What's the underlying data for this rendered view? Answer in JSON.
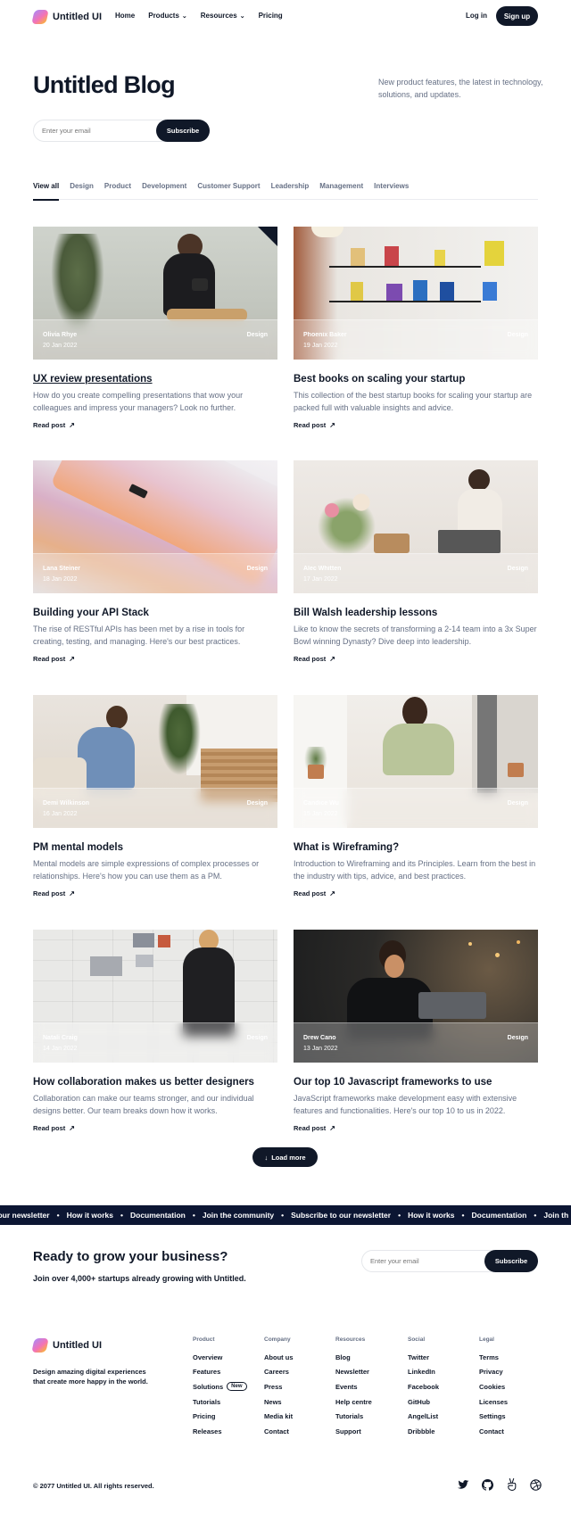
{
  "nav": {
    "brand": "Untitled UI",
    "links": [
      {
        "label": "Home"
      },
      {
        "label": "Products",
        "chevron": "⌄"
      },
      {
        "label": "Resources",
        "chevron": "⌄"
      },
      {
        "label": "Pricing"
      }
    ],
    "login": "Log in",
    "signup": "Sign up"
  },
  "hero": {
    "title": "Untitled Blog",
    "description": "New product features, the latest in technology, solutions, and updates.",
    "email_placeholder": "Enter your email",
    "subscribe": "Subscribe"
  },
  "tabs": [
    {
      "label": "View all",
      "active": true
    },
    {
      "label": "Design"
    },
    {
      "label": "Product"
    },
    {
      "label": "Development"
    },
    {
      "label": "Customer Support"
    },
    {
      "label": "Leadership"
    },
    {
      "label": "Management"
    },
    {
      "label": "Interviews"
    }
  ],
  "posts": [
    {
      "author": "Olivia Rhye",
      "date": "20 Jan 2022",
      "category": "Design",
      "title": "UX review presentations",
      "desc": "How do you create compelling presentations that wow your colleagues and impress your managers? Look no further.",
      "read": "Read post"
    },
    {
      "author": "Phoenix Baker",
      "date": "19 Jan 2022",
      "category": "Design",
      "title": "Best books on scaling your startup",
      "desc": "This collection of the best startup books for scaling your startup are packed full with valuable insights and advice.",
      "read": "Read post"
    },
    {
      "author": "Lana Steiner",
      "date": "18 Jan 2022",
      "category": "Design",
      "title": "Building your API Stack",
      "desc": "The rise of RESTful APIs has been met by a rise in tools for creating, testing, and managing. Here's our best practices.",
      "read": "Read post"
    },
    {
      "author": "Alec Whitten",
      "date": "17 Jan 2022",
      "category": "Design",
      "title": "Bill Walsh leadership lessons",
      "desc": "Like to know the secrets of transforming a 2-14 team into a 3x Super Bowl winning Dynasty? Dive deep into leadership.",
      "read": "Read post"
    },
    {
      "author": "Demi Wilkinson",
      "date": "16 Jan 2022",
      "category": "Design",
      "title": "PM mental models",
      "desc": "Mental models are simple expressions of complex processes or relationships. Here's how you can use them as a PM.",
      "read": "Read post"
    },
    {
      "author": "Candice Wu",
      "date": "15 Jan 2022",
      "category": "Design",
      "title": "What is Wireframing?",
      "desc": "Introduction to Wireframing and its Principles. Learn from the best in the industry with tips, advice, and best practices.",
      "read": "Read post"
    },
    {
      "author": "Natali Craig",
      "date": "14 Jan 2022",
      "category": "Design",
      "title": "How collaboration makes us better designers",
      "desc": "Collaboration can make our teams stronger, and our individual designs better. Our team breaks down how it works.",
      "read": "Read post"
    },
    {
      "author": "Drew Cano",
      "date": "13 Jan 2022",
      "category": "Design",
      "title": "Our top 10 Javascript frameworks to use",
      "desc": "JavaScript frameworks make development easy with extensive features and functionalities. Here's our top 10 to us in 2022.",
      "read": "Read post"
    }
  ],
  "load_more": "Load more",
  "marquee": {
    "sep": "•",
    "items": [
      "e to our newsletter",
      "How it works",
      "Documentation",
      "Join the community",
      "Subscribe to our newsletter",
      "How it works",
      "Documentation",
      "Join th"
    ]
  },
  "cta": {
    "title": "Ready to grow your business?",
    "subtitle": "Join over 4,000+ startups already growing with Untitled.",
    "email_placeholder": "Enter your email",
    "button": "Subscribe"
  },
  "footer": {
    "brand": "Untitled UI",
    "tagline": "Design amazing digital experiences that create more happy in the world.",
    "columns": [
      {
        "heading": "Product",
        "links": [
          "Overview",
          "Features",
          "Solutions",
          "Tutorials",
          "Pricing",
          "Releases"
        ],
        "badge": "New"
      },
      {
        "heading": "Company",
        "links": [
          "About us",
          "Careers",
          "Press",
          "News",
          "Media kit",
          "Contact"
        ]
      },
      {
        "heading": "Resources",
        "links": [
          "Blog",
          "Newsletter",
          "Events",
          "Help centre",
          "Tutorials",
          "Support"
        ]
      },
      {
        "heading": "Social",
        "links": [
          "Twitter",
          "LinkedIn",
          "Facebook",
          "GitHub",
          "AngelList",
          "Dribbble"
        ]
      },
      {
        "heading": "Legal",
        "links": [
          "Terms",
          "Privacy",
          "Cookies",
          "Licenses",
          "Settings",
          "Contact"
        ]
      }
    ],
    "copyright": "© 2077 Untitled UI. All rights reserved.",
    "social_icons": [
      "twitter-icon",
      "github-icon",
      "angellist-icon",
      "dribbble-icon"
    ]
  }
}
